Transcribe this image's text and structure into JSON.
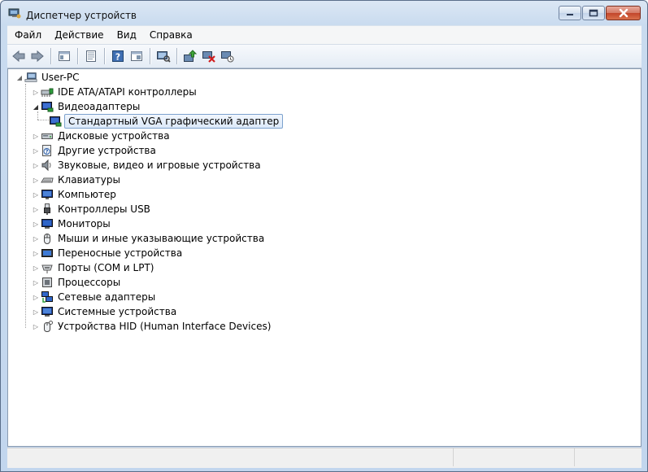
{
  "window": {
    "title": "Диспетчер устройств"
  },
  "menu": [
    "Файл",
    "Действие",
    "Вид",
    "Справка"
  ],
  "toolbar": {
    "buttons": [
      "back-arrow-icon",
      "forward-arrow-icon",
      "show-hide-tree-icon",
      "properties-icon",
      "help-icon",
      "view-icon",
      "scan-hardware-icon",
      "update-driver-icon",
      "uninstall-icon",
      "disable-icon"
    ]
  },
  "tree": {
    "root": "User-PC",
    "categories": [
      {
        "label": "IDE ATA/ATAPI контроллеры",
        "icon": "ide-controller-icon",
        "expanded": false
      },
      {
        "label": "Видеоадаптеры",
        "icon": "display-adapter-icon",
        "expanded": true,
        "children": [
          {
            "label": "Стандартный VGA графический адаптер",
            "icon": "display-adapter-icon",
            "selected": true
          }
        ]
      },
      {
        "label": "Дисковые устройства",
        "icon": "disk-drive-icon",
        "expanded": false
      },
      {
        "label": "Другие устройства",
        "icon": "unknown-device-icon",
        "expanded": false
      },
      {
        "label": "Звуковые, видео и игровые устройства",
        "icon": "speaker-icon",
        "expanded": false
      },
      {
        "label": "Клавиатуры",
        "icon": "keyboard-icon",
        "expanded": false
      },
      {
        "label": "Компьютер",
        "icon": "computer-icon",
        "expanded": false
      },
      {
        "label": "Контроллеры USB",
        "icon": "usb-icon",
        "expanded": false
      },
      {
        "label": "Мониторы",
        "icon": "monitor-icon",
        "expanded": false
      },
      {
        "label": "Мыши и иные указывающие устройства",
        "icon": "mouse-icon",
        "expanded": false
      },
      {
        "label": "Переносные устройства",
        "icon": "portable-device-icon",
        "expanded": false
      },
      {
        "label": "Порты (COM и LPT)",
        "icon": "port-icon",
        "expanded": false
      },
      {
        "label": "Процессоры",
        "icon": "processor-icon",
        "expanded": false
      },
      {
        "label": "Сетевые адаптеры",
        "icon": "network-adapter-icon",
        "expanded": false
      },
      {
        "label": "Системные устройства",
        "icon": "system-device-icon",
        "expanded": false
      },
      {
        "label": "Устройства HID (Human Interface Devices)",
        "icon": "hid-icon",
        "expanded": false
      }
    ]
  }
}
